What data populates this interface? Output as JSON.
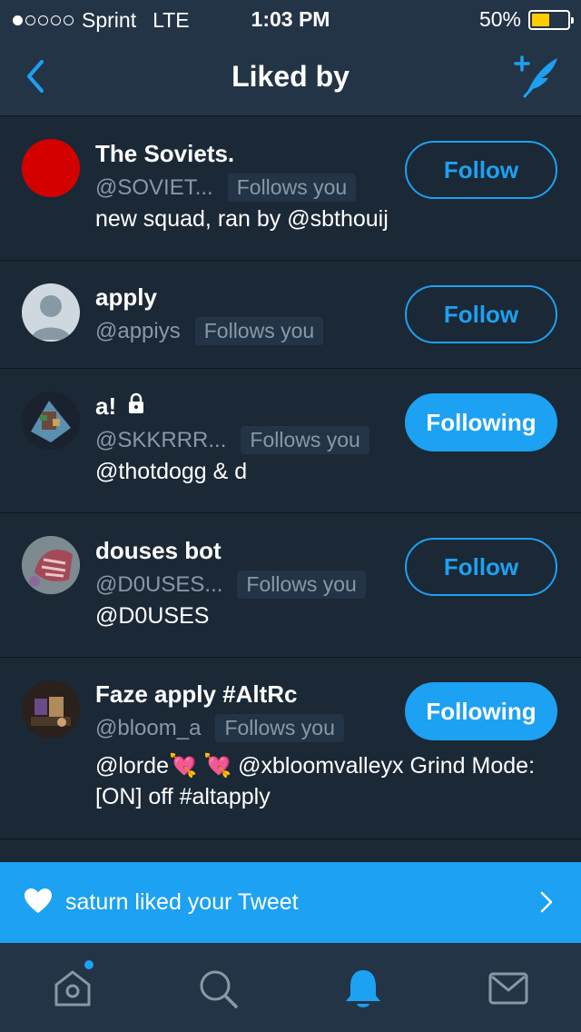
{
  "status_bar": {
    "carrier": "Sprint",
    "network": "LTE",
    "time": "1:03 PM",
    "battery": "50%",
    "battery_level": 0.5,
    "signal_bars": 1
  },
  "nav": {
    "title": "Liked by",
    "back_icon": "chevron-left-icon",
    "compose_icon": "compose-tweet-icon"
  },
  "users": [
    {
      "name": "The Soviets.",
      "handle": "@SOVIET...",
      "follows_you": "Follows you",
      "bio": "new squad, ran by @sbthouij",
      "button": "Follow",
      "following": false,
      "avatar_color": "#d40000",
      "locked": false
    },
    {
      "name": "apply",
      "handle": "@appiys",
      "follows_you": "Follows you",
      "bio": "",
      "button": "Follow",
      "following": false,
      "avatar_color": "#cfd8df",
      "locked": false
    },
    {
      "name": "a!",
      "handle": "@SKKRRR...",
      "follows_you": "Follows you",
      "bio": "@thotdogg & d",
      "button": "Following",
      "following": true,
      "avatar_color": "#2b3a4a",
      "locked": true
    },
    {
      "name": "douses bot",
      "handle": "@D0USES...",
      "follows_you": "Follows you",
      "bio": "@D0USES",
      "button": "Follow",
      "following": false,
      "avatar_color": "#8a5a5a",
      "locked": false
    },
    {
      "name": "Faze apply #AltRc",
      "handle": "@bloom_a",
      "follows_you": "Follows you",
      "bio": "@lorde💘 💘 @xbloomvalleyx Grind Mode: [ON] off #altapply",
      "button": "Following",
      "following": true,
      "avatar_color": "#3a2a22",
      "locked": false
    }
  ],
  "notification": {
    "text": "saturn liked your Tweet",
    "icon": "heart-icon"
  },
  "tabs": [
    {
      "name": "home",
      "icon": "home-icon",
      "has_badge": true
    },
    {
      "name": "search",
      "icon": "search-icon",
      "has_badge": false
    },
    {
      "name": "notifications",
      "icon": "bell-icon",
      "has_badge": false,
      "active": true
    },
    {
      "name": "messages",
      "icon": "mail-icon",
      "has_badge": false
    }
  ],
  "colors": {
    "accent": "#1da1f2",
    "background": "#1b2836",
    "bar": "#243447",
    "muted": "#8899a6"
  }
}
